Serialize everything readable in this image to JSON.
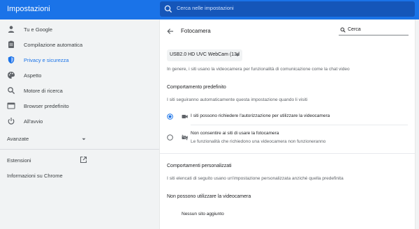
{
  "header": {
    "title": "Impostazioni",
    "search_placeholder": "Cerca nelle impostazioni"
  },
  "sidebar": {
    "items": [
      {
        "label": "Tu e Google",
        "icon": "person-icon"
      },
      {
        "label": "Compilazione automatica",
        "icon": "clipboard-icon"
      },
      {
        "label": "Privacy e sicurezza",
        "icon": "shield-icon",
        "active": true
      },
      {
        "label": "Aspetto",
        "icon": "palette-icon"
      },
      {
        "label": "Motore di ricerca",
        "icon": "search-icon"
      },
      {
        "label": "Browser predefinito",
        "icon": "browser-window-icon"
      },
      {
        "label": "All'avvio",
        "icon": "power-icon"
      }
    ],
    "advanced_label": "Avanzate",
    "extensions_label": "Estensioni",
    "about_label": "Informazioni su Chrome"
  },
  "page": {
    "title": "Fotocamera",
    "search_value": "Cerca",
    "device_select": "USB2.0 HD UVC WebCam (13d",
    "intro": "In genere, i siti usano la videocamera per funzionalità di comunicazione come la chat video",
    "default_heading": "Comportamento predefinito",
    "default_desc": "I siti seguiranno automaticamente questa impostazione quando li visiti",
    "option_allow": "I siti possono richiedere l'autorizzazione per utilizzare la videocamera",
    "option_block": "Non consentire ai siti di usare la fotocamera",
    "option_block_sub": "Le funzionalità che richiedono una videocamera non funzioneranno",
    "custom_heading": "Comportamenti personalizzati",
    "custom_desc": "I siti elencati di seguito usano un'impostazione personalizzata anziché quella predefinita",
    "blocked_heading": "Non possono utilizzare la videocamera",
    "blocked_empty": "Nessun sito aggiunto"
  },
  "colors": {
    "accent": "#1a73e8",
    "header_search_bg": "#1556b9",
    "sidebar_bg": "#f1f3f4"
  }
}
